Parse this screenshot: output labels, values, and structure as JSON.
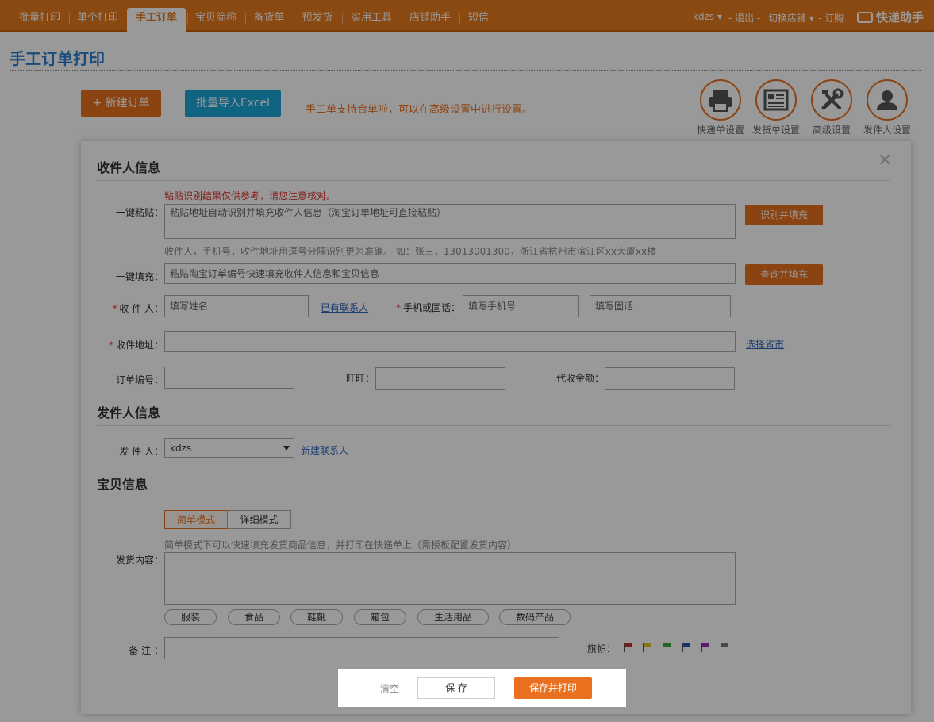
{
  "nav": {
    "tabs": [
      "批量打印",
      "单个打印",
      "手工订单",
      "宝贝简称",
      "备货单",
      "预发货",
      "实用工具",
      "店铺助手",
      "短信"
    ],
    "user": "kdzs",
    "logout": "- 退出 -",
    "switch_shop": "切换店铺",
    "order": "- 订购",
    "logo": "快递助手"
  },
  "page": {
    "title": "手工订单打印",
    "new_order_label": "+ 新建订单",
    "import_excel_label": "批量导入Excel",
    "tip": "手工单支持合单啦，可以在高级设置中进行设置。"
  },
  "tools": [
    {
      "label": "快递单设置",
      "icon": "printer-icon"
    },
    {
      "label": "发货单设置",
      "icon": "invoice-icon"
    },
    {
      "label": "高级设置",
      "icon": "tools-icon"
    },
    {
      "label": "发件人设置",
      "icon": "user-icon"
    }
  ],
  "recipient": {
    "heading": "收件人信息",
    "paste_warning": "粘贴识别结果仅供参考，请您注意核对。",
    "paste_label": "一键粘贴：",
    "paste_placeholder": "粘贴地址自动识别并填充收件人信息（淘宝订单地址可直接粘贴）",
    "recognize_btn": "识别并填充",
    "paste_hint": "收件人，手机号，收件地址用逗号分隔识别更为准确。 如：张三，13013001300，浙江省杭州市滨江区xx大厦xx楼",
    "fill_label": "一键填充：",
    "fill_placeholder": "粘贴淘宝订单编号快速填充收件人信息和宝贝信息",
    "query_btn": "查询并填充",
    "name_label": "收 件 人：",
    "name_placeholder": "填写姓名",
    "existing_contact": "已有联系人",
    "phone_label": "手机或固话：",
    "mobile_placeholder": "填写手机号",
    "tel_placeholder": "填写固话",
    "address_label": "收件地址：",
    "choose_province": "选择省市",
    "order_no_label": "订单编号：",
    "wangwang_label": "旺旺：",
    "cod_label": "代收金额："
  },
  "sender": {
    "heading": "发件人信息",
    "label": "发 件 人：",
    "selected": "kdzs",
    "new_contact": "新建联系人"
  },
  "goods": {
    "heading": "宝贝信息",
    "mode_simple": "简单模式",
    "mode_detail": "详细模式",
    "hint": "简单模式下可以快速填充发货商品信息，并打印在快递单上（需模板配置发货内容）",
    "content_label": "发货内容：",
    "chips": [
      "服装",
      "食品",
      "鞋靴",
      "箱包",
      "生活用品",
      "数码产品"
    ],
    "remark_label": "备 注 ：",
    "flag_label": "旗帜："
  },
  "flags": [
    "#d42b2b",
    "#e8c21e",
    "#3aa83a",
    "#2a4fc0",
    "#a02ac0",
    "#777777"
  ],
  "savebar": {
    "clear": "清空",
    "save": "保 存",
    "save_print": "保存并打印"
  }
}
